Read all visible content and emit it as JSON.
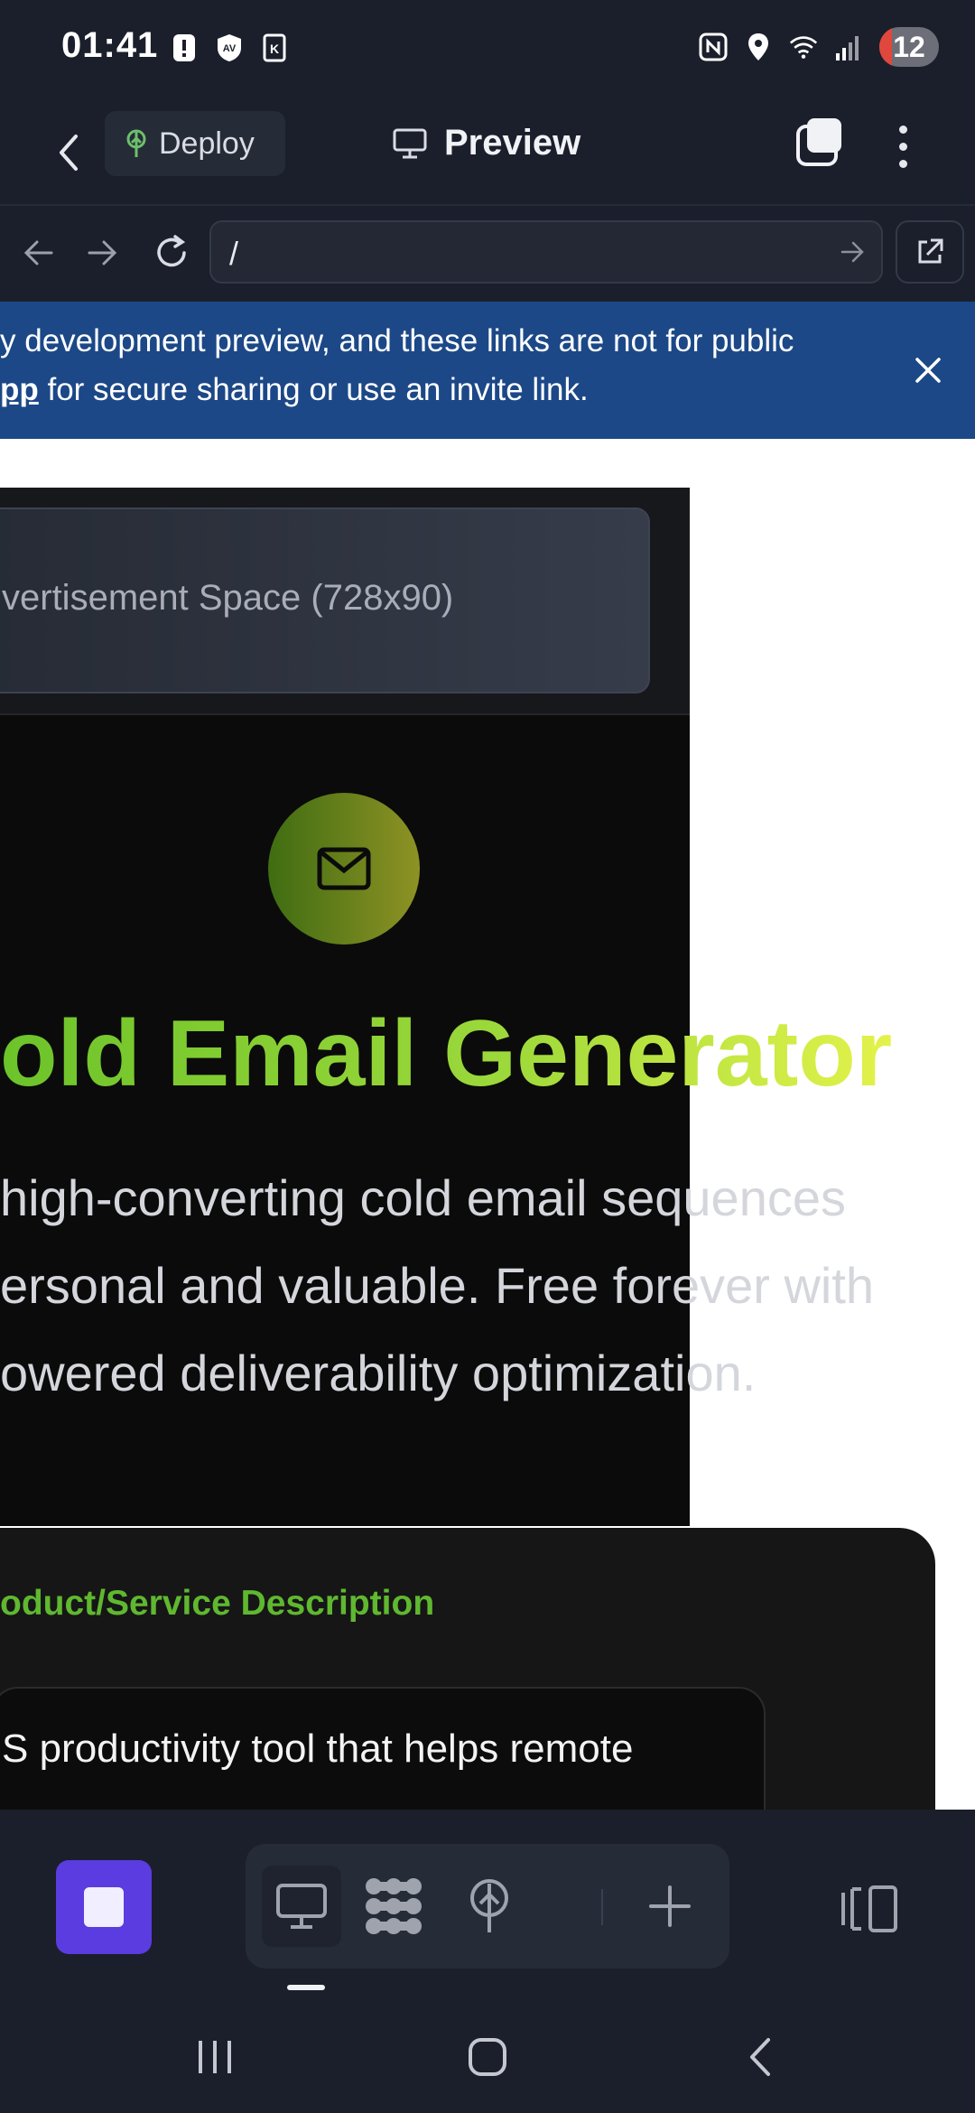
{
  "status_bar": {
    "time": "01:41",
    "left_icons": [
      "alert-icon",
      "av-shield-icon",
      "k-app-icon"
    ],
    "right_icons": [
      "nfc-icon",
      "location-icon",
      "wifi-icon",
      "signal-icon"
    ],
    "battery": "12"
  },
  "header": {
    "deploy_label": "Deploy",
    "title": "Preview"
  },
  "url_bar": {
    "value": "/"
  },
  "banner": {
    "line1": "y development preview, and these links are not for public",
    "line2_bold": "pp",
    "line2_rest": " for secure sharing or use an invite link.",
    "color": "#1c4887"
  },
  "webpage": {
    "ad_text": "vertisement Space (728x90)",
    "title": "old Email Generator",
    "description_lines": [
      "high-converting cold email sequences",
      "ersonal and valuable. Free forever with",
      "owered deliverability optimization."
    ],
    "field_label": "oduct/Service Description",
    "field_value": "S productivity tool that helps remote",
    "accent_color": "#6cc32a"
  },
  "toolbar": {
    "tools": [
      "desktop-icon",
      "apps-icon",
      "deploy-icon",
      "add-icon"
    ],
    "accent": "#5b3ce0"
  }
}
